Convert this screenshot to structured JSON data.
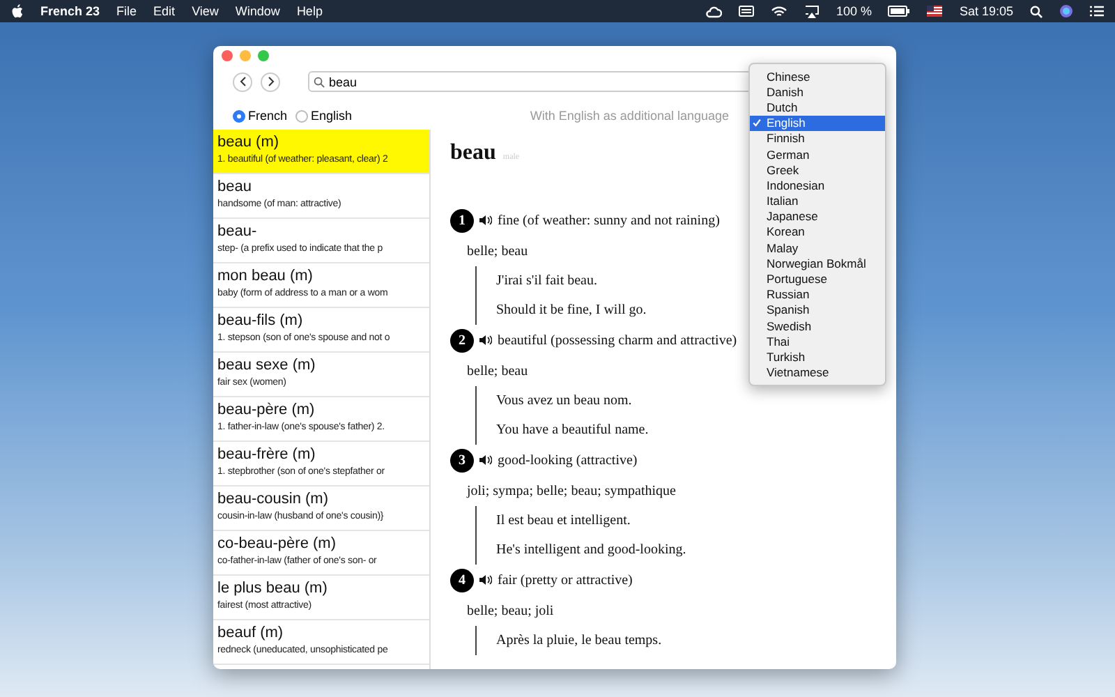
{
  "menubar": {
    "app_name": "French 23",
    "menus": [
      "File",
      "Edit",
      "View",
      "Window",
      "Help"
    ],
    "battery_text": "100 %",
    "clock": "Sat 19:05"
  },
  "window": {
    "search": {
      "value": "beau"
    },
    "source_languages": [
      {
        "label": "French",
        "selected": true
      },
      {
        "label": "English",
        "selected": false
      }
    ],
    "additional_language_label": "With English as additional language",
    "results": [
      {
        "headword": "beau (m)",
        "gloss": "1. beautiful (of weather: pleasant, clear) 2",
        "selected": true
      },
      {
        "headword": "beau",
        "gloss": "handsome (of man: attractive)",
        "selected": false
      },
      {
        "headword": "beau-",
        "gloss": "step- (a prefix used to indicate that the p",
        "selected": false
      },
      {
        "headword": "mon beau (m)",
        "gloss": "baby (form of address to a man or a wom",
        "selected": false
      },
      {
        "headword": "beau-fils (m)",
        "gloss": "1. stepson (son of one's spouse and not o",
        "selected": false
      },
      {
        "headword": "beau sexe (m)",
        "gloss": "fair sex (women)",
        "selected": false
      },
      {
        "headword": "beau-père (m)",
        "gloss": "1. father-in-law (one's spouse's father) 2.",
        "selected": false
      },
      {
        "headword": "beau-frère (m)",
        "gloss": "1. stepbrother (son of one's stepfather or",
        "selected": false
      },
      {
        "headword": "beau-cousin (m)",
        "gloss": "cousin-in-law (husband of one's cousin)}",
        "selected": false
      },
      {
        "headword": "co-beau-père (m)",
        "gloss": "co-father-in-law (father of one's son- or",
        "selected": false
      },
      {
        "headword": "le plus beau (m)",
        "gloss": "fairest (most attractive)",
        "selected": false
      },
      {
        "headword": "beauf (m)",
        "gloss": "redneck (uneducated, unsophisticated pe",
        "selected": false
      }
    ],
    "entry": {
      "headword": "beau",
      "gender": "male",
      "senses": [
        {
          "number": "1",
          "definition": "fine (of weather: sunny and not raining)",
          "translations": "belle; beau",
          "examples": [
            "J'irai s'il fait beau.",
            "Should it be fine, I will go."
          ]
        },
        {
          "number": "2",
          "definition": "beautiful (possessing charm and attractive)",
          "translations": "belle; beau",
          "examples": [
            "Vous avez un beau nom.",
            "You have a beautiful name."
          ]
        },
        {
          "number": "3",
          "definition": "good-looking (attractive)",
          "translations": "joli; sympa; belle; beau; sympathique",
          "examples": [
            "Il est beau et intelligent.",
            "He's intelligent and good-looking."
          ]
        },
        {
          "number": "4",
          "definition": "fair (pretty or attractive)",
          "translations": "belle; beau; joli",
          "examples": [
            "Après la pluie, le beau temps."
          ]
        }
      ]
    }
  },
  "language_menu": [
    {
      "label": "Chinese",
      "selected": false
    },
    {
      "label": "Danish",
      "selected": false
    },
    {
      "label": "Dutch",
      "selected": false
    },
    {
      "label": "English",
      "selected": true
    },
    {
      "label": "Finnish",
      "selected": false
    },
    {
      "label": "German",
      "selected": false
    },
    {
      "label": "Greek",
      "selected": false
    },
    {
      "label": "Indonesian",
      "selected": false
    },
    {
      "label": "Italian",
      "selected": false
    },
    {
      "label": "Japanese",
      "selected": false
    },
    {
      "label": "Korean",
      "selected": false
    },
    {
      "label": "Malay",
      "selected": false
    },
    {
      "label": "Norwegian Bokmål",
      "selected": false
    },
    {
      "label": "Portuguese",
      "selected": false
    },
    {
      "label": "Russian",
      "selected": false
    },
    {
      "label": "Spanish",
      "selected": false
    },
    {
      "label": "Swedish",
      "selected": false
    },
    {
      "label": "Thai",
      "selected": false
    },
    {
      "label": "Turkish",
      "selected": false
    },
    {
      "label": "Vietnamese",
      "selected": false
    }
  ]
}
